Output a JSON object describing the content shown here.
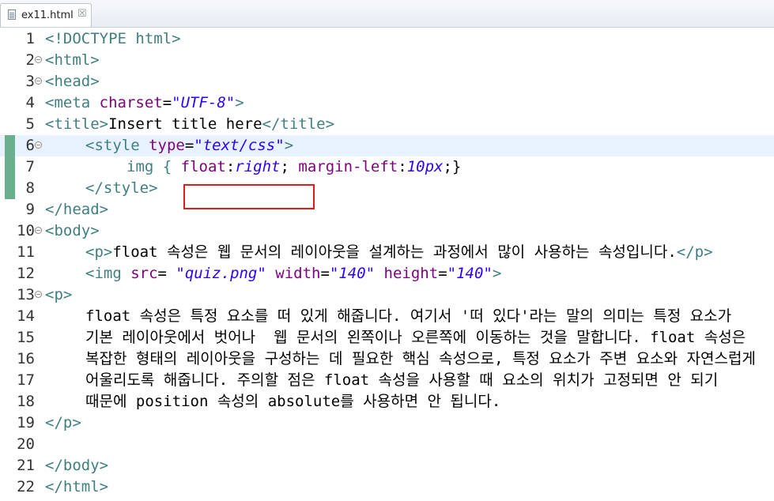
{
  "tab": {
    "title": "ex11.html",
    "close_glyph": "☒"
  },
  "lines": [
    {
      "num": "1",
      "parts": [
        "<!DOCTYPE html>"
      ]
    },
    {
      "num": "2",
      "parts": [
        "<html>"
      ]
    },
    {
      "num": "3",
      "parts": [
        "<head>"
      ]
    },
    {
      "num": "4",
      "parts": [
        "<meta",
        " charset",
        "=",
        "\"UTF-8\"",
        ">"
      ]
    },
    {
      "num": "5",
      "parts": [
        "<title>",
        "Insert title here",
        "</title>"
      ]
    },
    {
      "num": "6",
      "parts": [
        "<style",
        " type",
        "=",
        "\"text/css\"",
        ">"
      ]
    },
    {
      "num": "7",
      "parts": [
        "img { ",
        "float",
        ":",
        "right",
        "; ",
        "margin-left",
        ":",
        "10px",
        ";}"
      ]
    },
    {
      "num": "8",
      "parts": [
        "</style>"
      ]
    },
    {
      "num": "9",
      "parts": [
        "</head>"
      ]
    },
    {
      "num": "10",
      "parts": [
        "<body>"
      ]
    },
    {
      "num": "11",
      "parts": [
        "<p>",
        "float 속성은 웹 문서의 레이아웃을 설계하는 과정에서 많이 사용하는 속성입니다.",
        "</p>"
      ]
    },
    {
      "num": "12",
      "parts": [
        "<img",
        " src",
        "= ",
        "\"quiz.png\"",
        " width",
        "=",
        "\"140\"",
        " height",
        "=",
        "\"140\"",
        ">"
      ]
    },
    {
      "num": "13",
      "parts": [
        "<p>"
      ]
    },
    {
      "num": "14",
      "parts": [
        "float 속성은 특정 요소를 떠 있게 해줍니다. 여기서 '떠 있다'라는 말의 의미는 특정 요소가"
      ]
    },
    {
      "num": "15",
      "parts": [
        "기본 레이아웃에서 벗어나  웹 문서의 왼쪽이나 오른쪽에 이동하는 것을 말합니다. float 속성은"
      ]
    },
    {
      "num": "16",
      "parts": [
        "복잡한 형태의 레이아웃을 구성하는 데 필요한 핵심 속성으로, 특정 요소가 주변 요소와 자연스럽게"
      ]
    },
    {
      "num": "17",
      "parts": [
        "어울리도록 해줍니다. 주의할 점은 float 속성을 사용할 때 요소의 위치가 고정되면 안 되기"
      ]
    },
    {
      "num": "18",
      "parts": [
        "때문에 position 속성의 absolute를 사용하면 안 됩니다."
      ]
    },
    {
      "num": "19",
      "parts": [
        "</p>"
      ]
    },
    {
      "num": "20",
      "parts": [
        ""
      ]
    },
    {
      "num": "21",
      "parts": [
        "</body>"
      ]
    },
    {
      "num": "22",
      "parts": [
        "</html>"
      ]
    }
  ],
  "colors": {
    "tag": "#3f7f7f",
    "attribute": "#7f007f",
    "attribute_value": "#2a00ff",
    "current_line": "#e8f2fe",
    "change_marker": "#6aaf8e",
    "highlight_box": "#e01b1b"
  },
  "icons": {
    "file": "html-file-icon",
    "close": "close-icon",
    "fold": "fold-collapse-icon"
  }
}
